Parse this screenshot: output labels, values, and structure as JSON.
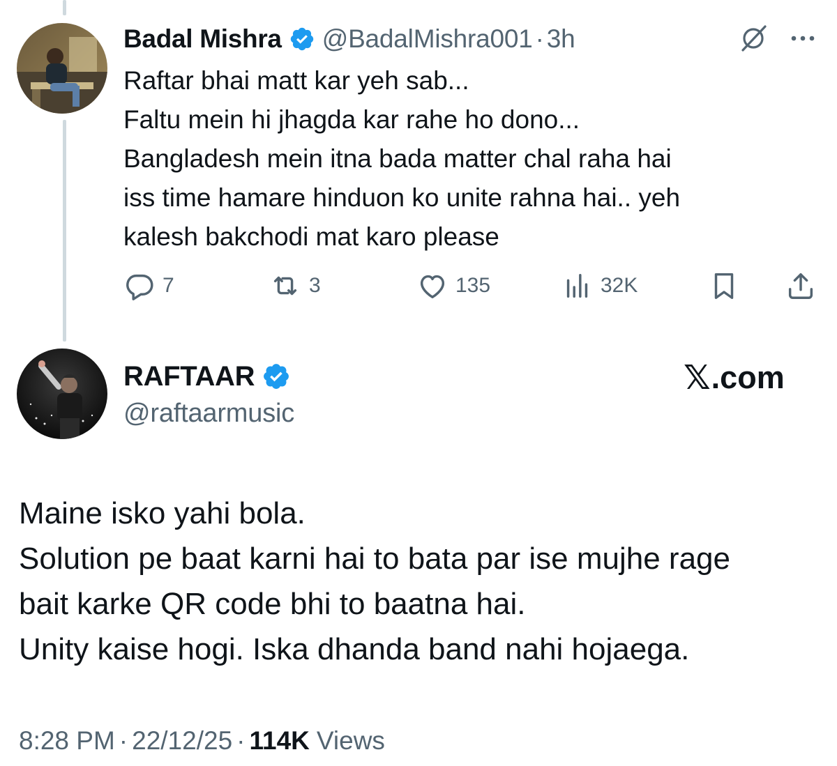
{
  "reply": {
    "author": {
      "name": "Badal Mishra",
      "handle": "@BadalMishra001",
      "separator": "·",
      "time": "3h",
      "verified_color": "#1d9bf0"
    },
    "lines": [
      "Raftar bhai matt kar yeh sab...",
      "Faltu mein hi jhagda kar rahe ho dono...",
      "Bangladesh mein itna bada matter chal raha hai",
      "iss time hamare hinduon ko unite rahna hai.. yeh",
      "kalesh bakchodi mat karo please"
    ],
    "actions": {
      "replies": "7",
      "reposts": "3",
      "likes": "135",
      "views": "32K"
    },
    "icons": [
      "grok-icon",
      "more-icon",
      "reply-icon",
      "repost-icon",
      "like-icon",
      "views-icon",
      "bookmark-icon",
      "share-icon"
    ]
  },
  "main": {
    "author": {
      "name": "RAFTAAR",
      "handle": "@raftaarmusic",
      "verified_color": "#1d9bf0"
    },
    "watermark": {
      "x": "𝕏",
      "text": ".com"
    },
    "lines": [
      "Maine isko yahi bola.",
      "Solution pe baat karni hai to bata par ise mujhe rage",
      "bait karke QR code bhi to baatna hai.",
      "Unity kaise hogi. Iska dhanda band nahi hojaega."
    ],
    "footer": {
      "time": "8:28 PM",
      "sep1": "·",
      "date": "22/12/25",
      "sep2": "·",
      "views_count": "114K",
      "views_label": "Views"
    }
  },
  "colors": {
    "text": "#0f1419",
    "secondary": "#536471",
    "accent": "#1d9bf0",
    "thread_line": "#cfd9de"
  }
}
